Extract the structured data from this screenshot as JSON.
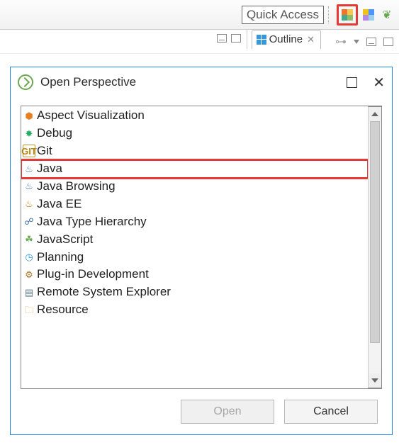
{
  "toolbar": {
    "quick_access": "Quick Access"
  },
  "tabs": {
    "outline": "Outline"
  },
  "dialog": {
    "title": "Open Perspective",
    "open_label": "Open",
    "cancel_label": "Cancel"
  },
  "perspectives": [
    {
      "label": "Aspect Visualization",
      "icon": "aspect"
    },
    {
      "label": "Debug",
      "icon": "debug"
    },
    {
      "label": "Git",
      "icon": "git"
    },
    {
      "label": "Java",
      "icon": "java",
      "highlighted": true
    },
    {
      "label": "Java Browsing",
      "icon": "java"
    },
    {
      "label": "Java EE",
      "icon": "jee"
    },
    {
      "label": "Java Type Hierarchy",
      "icon": "jth"
    },
    {
      "label": "JavaScript",
      "icon": "js"
    },
    {
      "label": "Planning",
      "icon": "clock"
    },
    {
      "label": "Plug-in Development",
      "icon": "plug"
    },
    {
      "label": "Remote System Explorer",
      "icon": "remote"
    },
    {
      "label": "Resource",
      "icon": "res"
    }
  ]
}
